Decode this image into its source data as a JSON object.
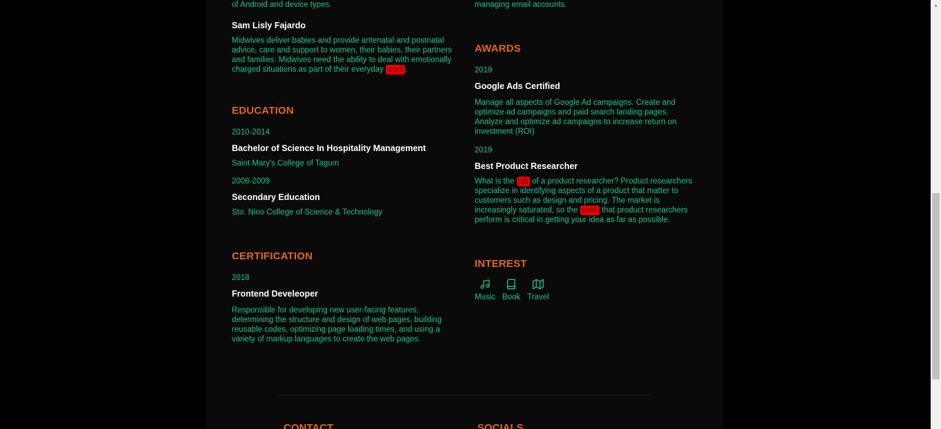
{
  "left": {
    "intro_tail": "attention to the application's compatibility with multiple versions of Android and device types.",
    "reference": {
      "name": "Sam Lisly Fajardo",
      "desc_before": "Midwives deliver babies and provide antenatal and postnatal advice, care and support to women, their babies, their partners and families. Midwives need the ability to deal with emotionally charged situations as part of their everyday ",
      "desc_highlight": "work",
      "desc_after": "."
    },
    "education": {
      "title": "EDUCATION",
      "items": [
        {
          "year": "2010-2014",
          "degree": "Bachelor of Science In Hospitality Management",
          "school": "Saint Mary's College of Tagum"
        },
        {
          "year": "2008-2009",
          "degree": "Secondary Education",
          "school": "Sto. Nino College of Science & Technology"
        }
      ]
    },
    "certification": {
      "title": "CERTIFICATION",
      "items": [
        {
          "year": "2018",
          "name": "Frontend Develeoper",
          "desc": "Responsible for developing new user-facing features, determining the structure and design of web pages, building reusable codes, optimizing page loading times, and using a variety of markup languages to create the web pages."
        }
      ]
    }
  },
  "right": {
    "intro_tail": "making phone calls, making travel arrangements, and managing email accounts.",
    "awards": {
      "title": "AWARDS",
      "items": [
        {
          "year": "2019",
          "name": "Google Ads Certified",
          "desc": "Manage all aspects of Google Ad campaigns. Create and optimize ad campaigns and paid search landing pages. Analyze and optimize ad campaigns to increase return on investment (ROI)"
        },
        {
          "year": "2019",
          "name": "Best Product Researcher",
          "desc_1": "What is the ",
          "hl_1": "job",
          "desc_2": " of a product researcher? Product researchers specialize in identifying aspects of a product that matter to customers such as design and pricing. The market is increasingly saturated, so the ",
          "hl_2": "work",
          "desc_3": " that product researchers perform is critical in getting your idea as far as possible."
        }
      ]
    },
    "interest": {
      "title": "INTEREST",
      "items": [
        {
          "label": "Music",
          "icon": "music-icon"
        },
        {
          "label": "Book",
          "icon": "book-icon"
        },
        {
          "label": "Travel",
          "icon": "map-icon"
        }
      ]
    }
  },
  "footer": {
    "contact_title": "CONTACT",
    "socials_title": "SOCIALS"
  },
  "colors": {
    "accent": "#e2661d",
    "text_green": "#20c38a",
    "highlight": "#ee0000",
    "background": "#0a0a0a"
  }
}
